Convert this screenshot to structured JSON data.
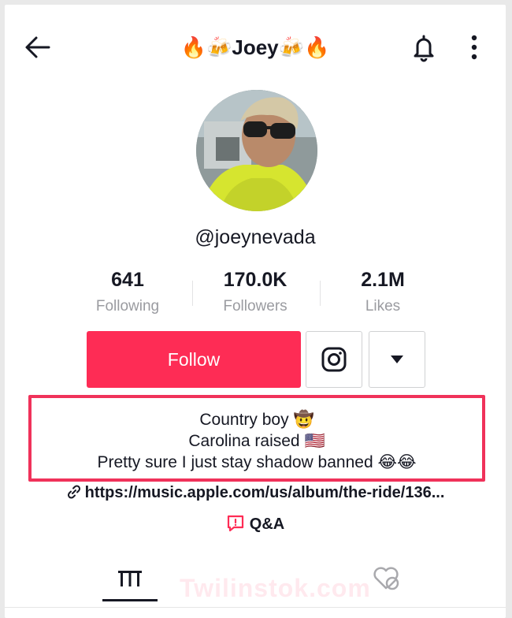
{
  "header": {
    "title_name": "Joey"
  },
  "profile": {
    "username": "@joeynevada"
  },
  "stats": [
    {
      "value": "641",
      "label": "Following"
    },
    {
      "value": "170.0K",
      "label": "Followers"
    },
    {
      "value": "2.1M",
      "label": "Likes"
    }
  ],
  "actions": {
    "follow_label": "Follow"
  },
  "bio": {
    "lines": [
      "Country boy 🤠",
      "Carolina raised 🇺🇸",
      "Pretty sure I just stay shadow banned 😂😂"
    ]
  },
  "link": {
    "text": "https://music.apple.com/us/album/the-ride/136..."
  },
  "qa": {
    "label": "Q&A"
  },
  "watermark": "Twilinstok.com",
  "colors": {
    "accent": "#fe2c55",
    "highlight_border": "#f0325a",
    "text": "#161823",
    "muted": "#9a9ba0"
  },
  "icons": {
    "back": "arrow-left-icon",
    "notifications": "bell-icon",
    "more": "vertical-dots-icon",
    "instagram": "instagram-icon",
    "dropdown": "triangle-down-icon",
    "link": "link-icon",
    "qa": "qa-bubble-icon",
    "videos_tab": "grid-icon",
    "liked_tab": "hidden-heart-icon"
  }
}
